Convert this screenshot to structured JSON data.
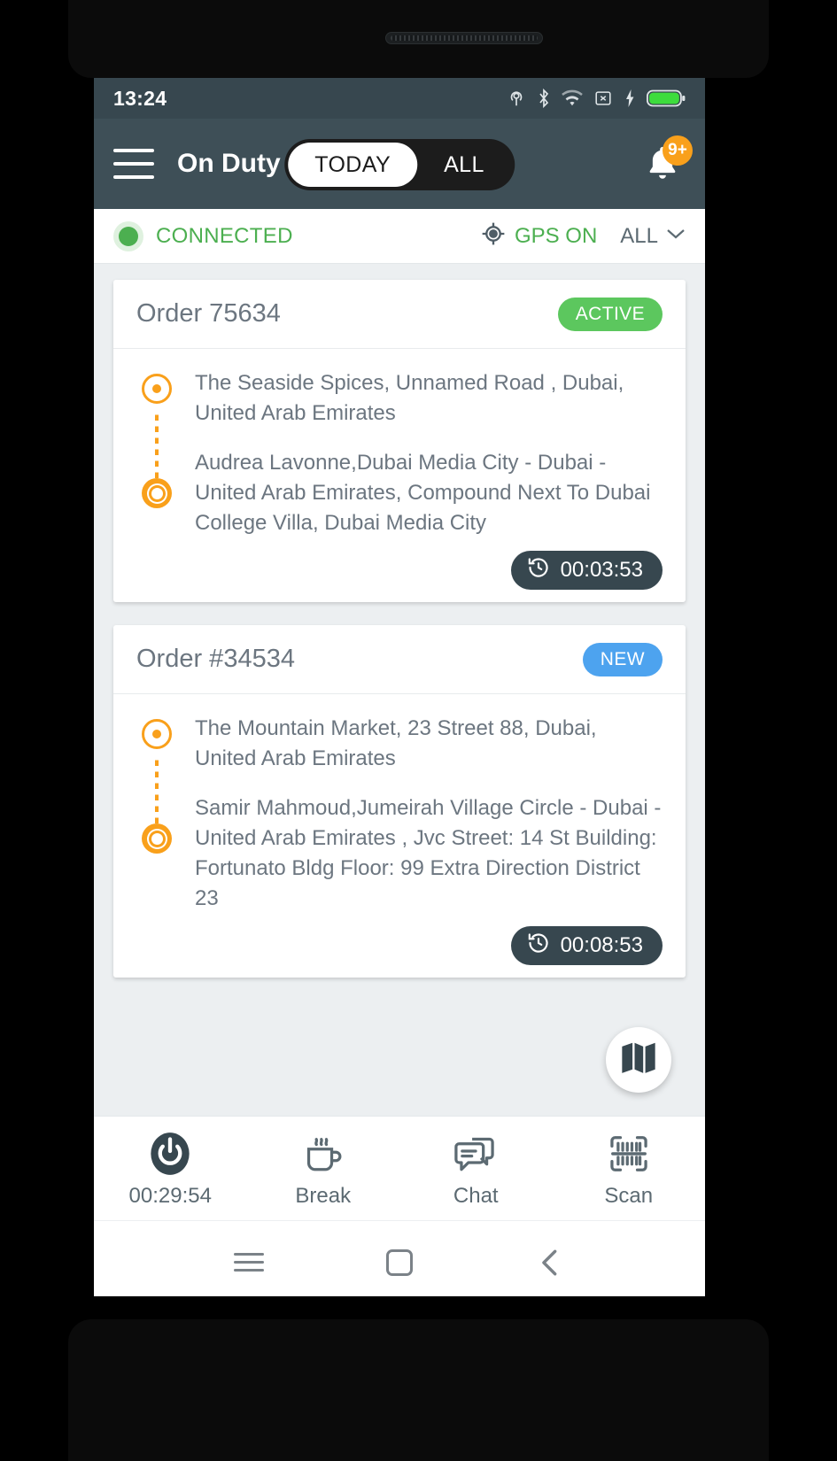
{
  "statusbar": {
    "time": "13:24",
    "icons": [
      "hotspot-icon",
      "bluetooth-icon",
      "wifi-icon",
      "sim-off-icon",
      "charging-bolt-icon",
      "battery-icon"
    ]
  },
  "appbar": {
    "menu_icon": "hamburger-menu-icon",
    "title": "On Duty",
    "segments": [
      {
        "label": "TODAY",
        "active": true
      },
      {
        "label": "ALL",
        "active": false
      }
    ],
    "notification_icon": "bell-icon",
    "notification_badge": "9+",
    "badge_color": "#f9a01b"
  },
  "connection": {
    "status_text": "CONNECTED",
    "status_color": "#4caf50",
    "gps_icon": "gps-crosshair-icon",
    "gps_text": "GPS ON",
    "filter_label": "ALL",
    "filter_icon": "chevron-down-icon"
  },
  "orders": [
    {
      "title": "Order 75634",
      "status": "ACTIVE",
      "status_color": "#5cc75e",
      "pickup": "The Seaside Spices, Unnamed Road , Dubai, United Arab Emirates",
      "dropoff": "Audrea Lavonne,Dubai Media City - Dubai - United Arab Emirates, Compound Next To Dubai College Villa, Dubai Media City",
      "timer": "00:03:53",
      "timer_icon": "history-clock-icon"
    },
    {
      "title": "Order #34534",
      "status": "NEW",
      "status_color": "#4da3ef",
      "pickup": "The Mountain Market, 23 Street 88, Dubai, United Arab Emirates",
      "dropoff": "Samir Mahmoud,Jumeirah Village Circle - Dubai - United Arab Emirates ,  Jvc Street: 14 St Building: Fortunato Bldg Floor: 99 Extra Direction District 23",
      "timer": "00:08:53",
      "timer_icon": "history-clock-icon"
    }
  ],
  "fab": {
    "icon": "map-icon"
  },
  "bottomnav": [
    {
      "icon": "power-icon",
      "label": "00:29:54"
    },
    {
      "icon": "coffee-cup-icon",
      "label": "Break"
    },
    {
      "icon": "chat-bubbles-icon",
      "label": "Chat"
    },
    {
      "icon": "barcode-scan-icon",
      "label": "Scan"
    }
  ],
  "androidnav": [
    {
      "icon": "recents-menu-icon"
    },
    {
      "icon": "home-square-icon"
    },
    {
      "icon": "back-chevron-icon"
    }
  ]
}
